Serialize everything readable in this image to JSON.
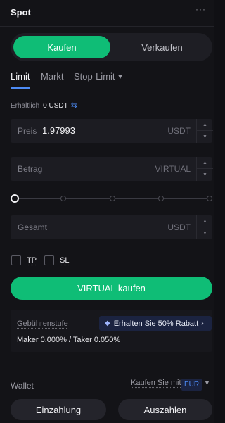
{
  "header": {
    "title": "Spot",
    "more_icon": "ellipsis-icon"
  },
  "side_toggle": {
    "buy_label": "Kaufen",
    "sell_label": "Verkaufen",
    "buy_color": "#0fbd76"
  },
  "order_tabs": {
    "limit": "Limit",
    "market": "Markt",
    "stop_limit": "Stop-Limit",
    "active": "Limit",
    "accent": "#4d8bf5"
  },
  "available": {
    "label": "Erhältlich",
    "value": "0 USDT",
    "icon": "swap-icon"
  },
  "price_field": {
    "label": "Preis",
    "value": "1.97993",
    "unit": "USDT"
  },
  "amount_field": {
    "label": "Betrag",
    "value": "",
    "unit": "VIRTUAL"
  },
  "slider": {
    "value_percent": 0,
    "steps": [
      0,
      25,
      50,
      75,
      100
    ]
  },
  "total_field": {
    "label": "Gesamt",
    "value": "",
    "unit": "USDT"
  },
  "options": {
    "tp_label": "TP",
    "sl_label": "SL",
    "tp_checked": false,
    "sl_checked": false
  },
  "submit": {
    "label": "VIRTUAL kaufen"
  },
  "fees": {
    "tier_label": "Gebührenstufe",
    "promo_text": "Erhalten Sie 50% Rabatt",
    "promo_icon": "diamond-icon",
    "rates": "Maker 0.000% / Taker 0.050%"
  },
  "wallet": {
    "label": "Wallet",
    "buy_with_label": "Kaufen Sie mit",
    "currency": "EUR",
    "deposit_label": "Einzahlung",
    "withdraw_label": "Auszahlen"
  }
}
